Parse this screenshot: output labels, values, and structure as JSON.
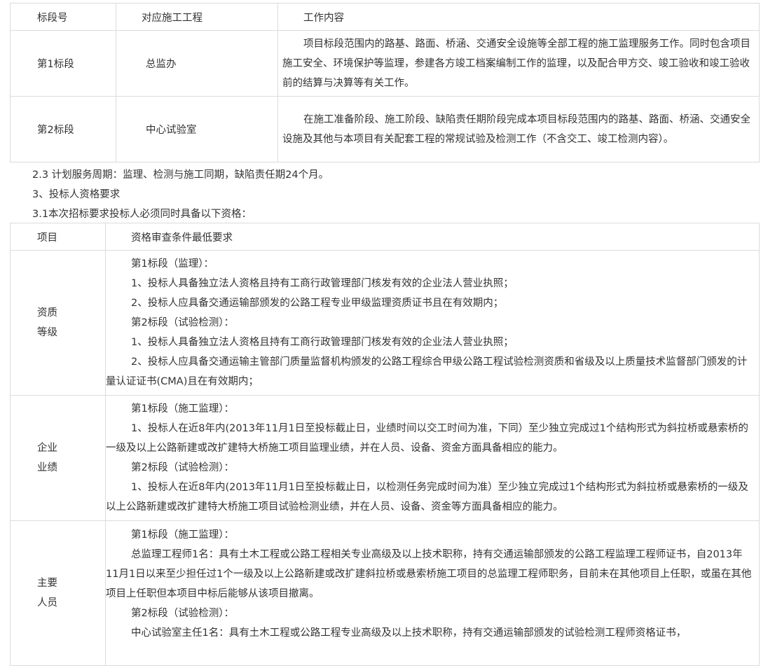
{
  "table1": {
    "headers": [
      "标段号",
      "对应施工工程",
      "工作内容"
    ],
    "rows": [
      {
        "section": "第1标段",
        "project": "总监办",
        "content": "项目标段范围内的路基、路面、桥涵、交通安全设施等全部工程的施工监理服务工作。同时包含项目施工安全、环境保护等监理，参建各方竣工档案编制工作的监理，以及配合甲方交、竣工验收和竣工验收前的结算与决算等有关工作。"
      },
      {
        "section": "第2标段",
        "project": "中心试验室",
        "content": "在施工准备阶段、施工阶段、缺陷责任期阶段完成本项目标段范围内的路基、路面、桥涵、交通安全设施及其他与本项目有关配套工程的常规试验及检测工作（不含交工、竣工检测内容）。"
      }
    ]
  },
  "lines": [
    "2.3 计划服务周期：监理、检测与施工同期，缺陷责任期24个月。",
    "3、投标人资格要求",
    "3.1本次招标要求投标人必须同时具备以下资格："
  ],
  "table2": {
    "headers": [
      "项目",
      "资格审查条件最低要求"
    ],
    "blocks": [
      {
        "label": [
          "资质",
          "等级"
        ],
        "items": [
          {
            "type": "heading",
            "text": "第1标段（监理）："
          },
          {
            "type": "para",
            "text": "1、投标人具备独立法人资格且持有工商行政管理部门核发有效的企业法人营业执照；"
          },
          {
            "type": "para",
            "text": "2、投标人应具备交通运输部颁发的公路工程专业甲级监理资质证书且在有效期内；"
          },
          {
            "type": "heading",
            "text": "第2标段（试验检测）："
          },
          {
            "type": "para",
            "text": "1、投标人具备独立法人资格且持有工商行政管理部门核发有效的企业法人营业执照；"
          },
          {
            "type": "para",
            "text": "2、投标人应具备交通运输主管部门质量监督机构颁发的公路工程综合甲级公路工程试验检测资质和省级及以上质量技术监督部门颁发的计量认证证书(CMA)且在有效期内；"
          }
        ]
      },
      {
        "label": [
          "企业",
          "业绩"
        ],
        "items": [
          {
            "type": "heading",
            "text": "第1标段（施工监理）："
          },
          {
            "type": "para",
            "text": "1、投标人在近8年内(2013年11月1日至投标截止日，业绩时间以交工时间为准，下同）至少独立完成过1个结构形式为斜拉桥或悬索桥的一级及以上公路新建或改扩建特大桥施工项目监理业绩，并在人员、设备、资金方面具备相应的能力。"
          },
          {
            "type": "heading",
            "text": "第2标段（试验检测）："
          },
          {
            "type": "para",
            "text": "1、投标人在近8年内(2013年11月1日至投标截止日，以检测任务完成时间为准）至少独立完成过1个结构形式为斜拉桥或悬索桥的一级及以上公路新建或改扩建特大桥施工项目试验检测业绩，并在人员、设备、资金等方面具备相应的能力。"
          }
        ]
      },
      {
        "label": [
          "主要",
          "人员"
        ],
        "items": [
          {
            "type": "heading",
            "text": "第1标段（施工监理）："
          },
          {
            "type": "para",
            "text": "总监理工程师1名：具有土木工程或公路工程相关专业高级及以上技术职称，持有交通运输部颁发的公路工程监理工程师证书，自2013年11月1日以来至少担任过1个一级及以上公路新建或改扩建斜拉桥或悬索桥施工项目的总监理工程师职务，目前未在其他项目上任职，或虽在其他项目上任职但本项目中标后能够从该项目撤离。"
          },
          {
            "type": "heading",
            "text": "第2标段（试验检测）："
          },
          {
            "type": "para",
            "text": "中心试验室主任1名：具有土木工程或公路工程专业高级及以上技术职称，持有交通运输部颁发的试验检测工程师资格证书，"
          }
        ]
      }
    ]
  }
}
